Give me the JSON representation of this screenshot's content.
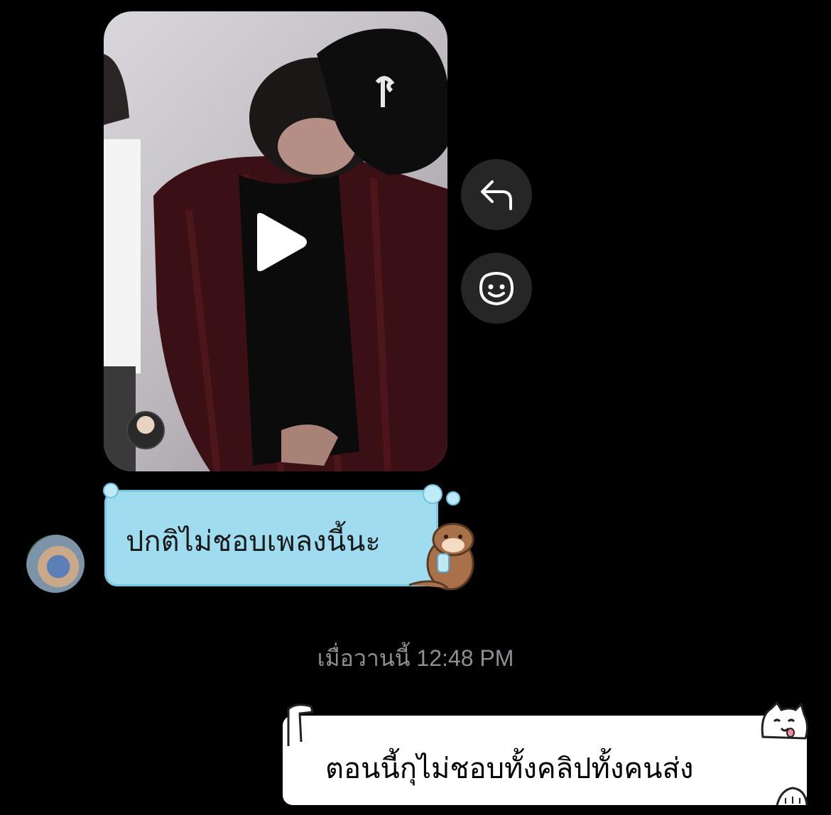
{
  "thread": {
    "shared_video": {
      "play_icon": "play-icon",
      "sender_avatar": "avatar"
    },
    "actions": {
      "reply_icon": "reply-icon",
      "react_icon": "smiley-icon"
    },
    "incoming_message": {
      "text": "ปกติไม่ชอบเพลงนี้นะ",
      "bubble_color": "#9fdcef",
      "sticker": "otter-sticker"
    },
    "timestamp": "เมื่อวานนี้ 12:48 PM",
    "outgoing_message": {
      "text": "ตอนนี้กุไม่ชอบทั้งคลิปทั้งคนส่ง",
      "bubble_color": "#ffffff",
      "sticker": "cat-sticker"
    }
  }
}
